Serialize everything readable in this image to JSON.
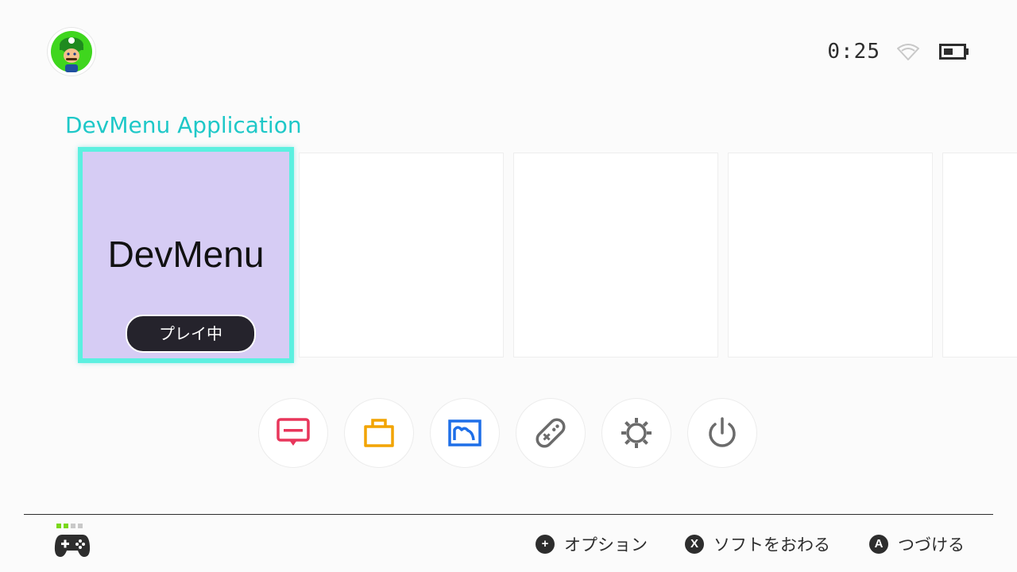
{
  "status_bar": {
    "time": "0:25",
    "wifi_icon": "wifi-icon",
    "battery_icon": "battery-icon"
  },
  "user": {
    "avatar_icon": "luigi-avatar"
  },
  "selected_title": "DevMenu Application",
  "tiles": [
    {
      "name": "DevMenu",
      "badge": "プレイ中",
      "selected": true,
      "color": "#d6ccf4"
    },
    {
      "name": "",
      "badge": "",
      "selected": false
    },
    {
      "name": "",
      "badge": "",
      "selected": false
    },
    {
      "name": "",
      "badge": "",
      "selected": false
    },
    {
      "name": "",
      "badge": "",
      "selected": false
    }
  ],
  "dock": [
    {
      "icon": "news-icon",
      "color": "#e8365b"
    },
    {
      "icon": "eshop-icon",
      "color": "#f2a400"
    },
    {
      "icon": "album-icon",
      "color": "#1e6fe8"
    },
    {
      "icon": "controllers-icon",
      "color": "#6b6b6b"
    },
    {
      "icon": "settings-icon",
      "color": "#6b6b6b"
    },
    {
      "icon": "power-icon",
      "color": "#6b6b6b"
    }
  ],
  "footer": {
    "controller_icon": "controller-icon",
    "player_led_color": "#7ad81a",
    "hints": [
      {
        "glyph": "+",
        "label": "オプション"
      },
      {
        "glyph": "X",
        "label": "ソフトをおわる"
      },
      {
        "glyph": "A",
        "label": "つづける"
      }
    ]
  },
  "colors": {
    "accent": "#1ec8c8",
    "selection_border": "#5cf0e0",
    "background": "#fbfbfb"
  }
}
